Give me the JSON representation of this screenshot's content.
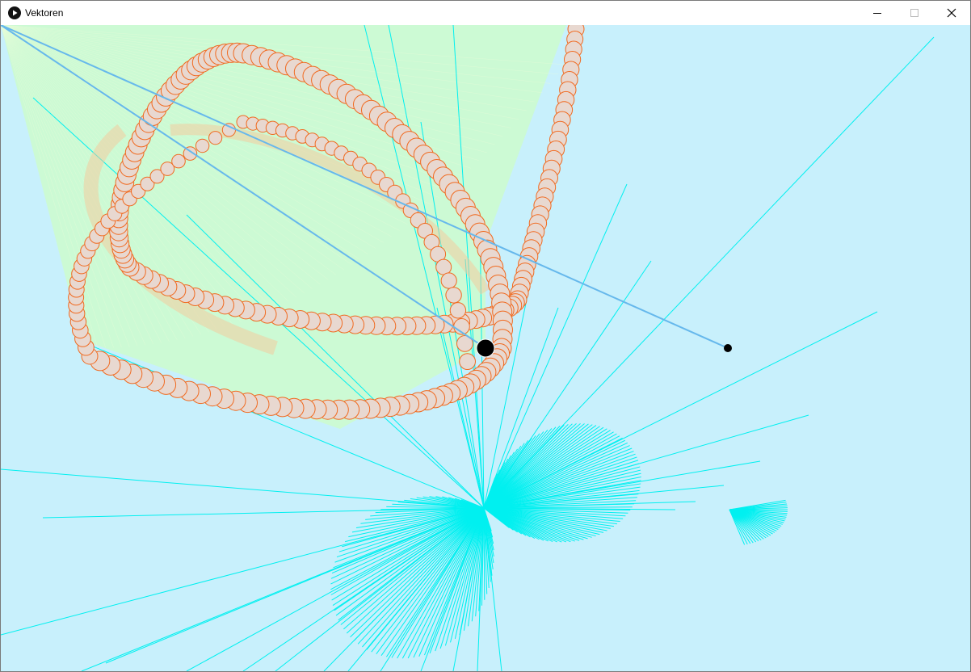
{
  "window": {
    "title": "Vektoren",
    "icon": "play-icon",
    "controls": [
      "minimize-icon",
      "maximize-icon",
      "close-icon"
    ]
  },
  "colors": {
    "canvas_bg": "#c8f0fc",
    "fan_fill": "#ccfccc",
    "cyan_lines": "#00f0f0",
    "blue_line": "#66b8ec",
    "circle_fill": "#e8d8d0",
    "circle_stroke": "#f06a20",
    "handle": "#000000"
  }
}
